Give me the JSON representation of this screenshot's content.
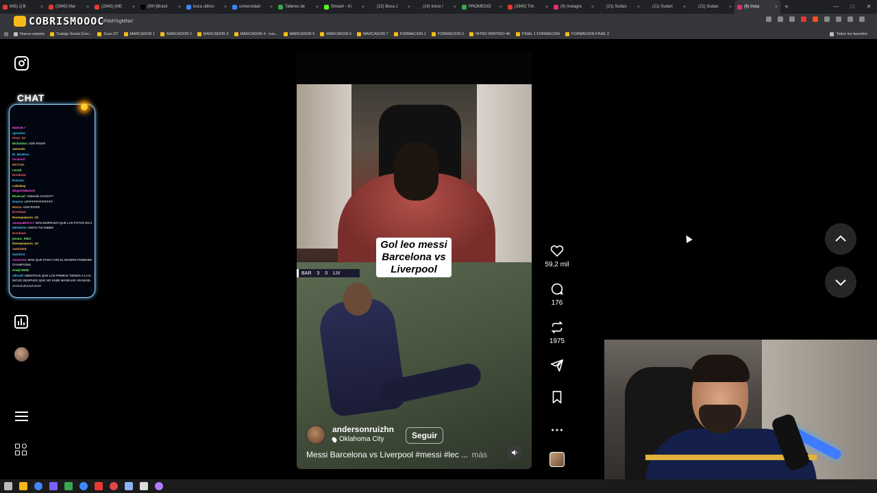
{
  "browser": {
    "tabs": [
      {
        "label": "845) Jj B",
        "color": "#e53935"
      },
      {
        "label": "(2845) Mar",
        "color": "#e53935"
      },
      {
        "label": "(2845) (ME",
        "color": "#e53935"
      },
      {
        "label": "(99+)Brasil",
        "color": "#000000"
      },
      {
        "label": "boca ultimo",
        "color": "#4285f4"
      },
      {
        "label": "universidad",
        "color": "#4285f4"
      },
      {
        "label": "Talleres de",
        "color": "#34a853"
      },
      {
        "label": "Stream - Ki",
        "color": "#53fc18"
      },
      {
        "label": "(22) Boca J",
        "color": "#222222"
      },
      {
        "label": "(16) Inicio /",
        "color": "#222222"
      },
      {
        "label": "PROMEDIO",
        "color": "#34a853"
      },
      {
        "label": "(2845) Tim",
        "color": "#e53935"
      },
      {
        "label": "(9) Instagra",
        "color": "#e1306c"
      },
      {
        "label": "(21) Sudan",
        "color": "#222222"
      },
      {
        "label": "(21) Sudan",
        "color": "#222222"
      },
      {
        "label": "(21) Sudan",
        "color": "#222222"
      },
      {
        "label": "(9) Insta",
        "color": "#e1306c",
        "active": true
      }
    ],
    "url_fragment": "/FkMYkgMNe/",
    "brand_overlay": "COBRISMOOOC",
    "bookmarks": [
      "Nueva carpeta",
      "Trabajo Social Com...",
      "Gran DT",
      "MARCADOR 1",
      "MARCADOR 2",
      "MARCADOR 3",
      "MARCADOR 4 - ove...",
      "MARCADOR 5",
      "MARCADOR 6",
      "MARCADOR 7",
      "FORMACION 1",
      "FORMACION 2",
      "INTRO PARTIDO 4K",
      "FINAL 1 FORMACION",
      "FORMACION FINAL 2"
    ],
    "all_bookmarks": "Todos los favoritos"
  },
  "sidebar": {
    "logo_icon": "instagram-icon",
    "chat_title": "CHAT",
    "chat_lines": [
      {
        "user": "Mateo8",
        "msg": "!",
        "color": "#ff4fd8"
      },
      {
        "user": "rgrnot21",
        "msg": "",
        "color": "#46c8ff"
      },
      {
        "user": "Pinto_02",
        "msg": "",
        "color": "#ff6b6b"
      },
      {
        "user": "Elchinitos",
        "msg": "ADN RIVER",
        "color": "#7cff6b"
      },
      {
        "user": "Jaevoda",
        "msg": "",
        "color": "#ffd84f"
      },
      {
        "user": "El_Mudeno",
        "msg": "",
        "color": "#46c8ff"
      },
      {
        "user": "luciano2",
        "msg": "",
        "color": "#ff4fd8"
      },
      {
        "user": "KK7716",
        "msg": "",
        "color": "#ffa64f"
      },
      {
        "user": "Leo10",
        "msg": "",
        "color": "#7cff6b"
      },
      {
        "user": "DrAdrian",
        "msg": "",
        "color": "#ff6b6b"
      },
      {
        "user": "Rumola",
        "msg": "",
        "color": "#46c8ff"
      },
      {
        "user": "LoboDay",
        "msg": "",
        "color": "#ffd84f"
      },
      {
        "user": "diegotr56bmod",
        "msg": "",
        "color": "#ff4fd8"
      },
      {
        "user": "Elcarcari",
        "msg": "Valverde el GOAT?",
        "color": "#7cff6b"
      },
      {
        "user": "Doyme",
        "msg": "UFFFFFFFFFFFFFF",
        "color": "#46c8ff"
      },
      {
        "user": "Nozzu",
        "msg": "ADN RIVER",
        "color": "#ffa64f"
      },
      {
        "user": "DrAdrian",
        "msg": "",
        "color": "#ff6b6b"
      },
      {
        "user": "Nosequepono_10",
        "msg": "",
        "color": "#ffd84f"
      },
      {
        "user": "JuanpaBOCA7",
        "msg": "MAS BORRADO QUE LAS FOTOS EN WANDA",
        "color": "#ff4fd8"
      },
      {
        "user": "NEGRON",
        "msg": "GRITO TIO RIBER",
        "color": "#46c8ff"
      },
      {
        "user": "DrAdrian",
        "msg": "",
        "color": "#ff6b6b"
      },
      {
        "user": "jovanc_felizi",
        "msg": "",
        "color": "#7cff6b"
      },
      {
        "user": "Nosequepono_10",
        "msg": "",
        "color": "#ffd84f"
      },
      {
        "user": "Jaeti1919",
        "msg": "",
        "color": "#ffa64f"
      },
      {
        "user": "SantiGO",
        "msg": "",
        "color": "#46c8ff"
      },
      {
        "user": "Jose1315",
        "msg": "MAE QUE PASO CON EL MADRID FEMENINO EN",
        "color": "#ff4fd8"
      },
      {
        "user": "",
        "msg": "CHAMPIONS",
        "color": "#ffffff"
      },
      {
        "user": "Andy72636",
        "msg": "",
        "color": "#7cff6b"
      },
      {
        "user": "Jdinolli",
        "msg": "MIENTRAS QUE LOS PRIMOS TIENEN A LA G A",
        "color": "#46c8ff"
      },
      {
        "user": "",
        "msg": "NICHO DESPUES QUE NO SABE MANEJAR UN MASIL",
        "color": "#ffffff"
      },
      {
        "user": "",
        "msg": "JAJAJAJAJAJAJAJA",
        "color": "#ffffff"
      }
    ],
    "stats_icon": "insights-icon",
    "menu_icon": "menu-icon",
    "more_icon": "more-apps-icon"
  },
  "reel": {
    "caption_overlay": [
      "Gol leo messi",
      "Barcelona vs",
      "Liverpool"
    ],
    "score": {
      "home": "BAR",
      "home_goals": "3",
      "away_goals": "0",
      "away": "LIV"
    },
    "username": "andersonruizhn",
    "location": "Oklahoma City",
    "follow_label": "Seguir",
    "description": "Messi Barcelona vs Liverpool #messi #lec ...",
    "more_label": "más"
  },
  "actions": {
    "likes": "59,2 mil",
    "comments": "176",
    "reposts": "1975"
  }
}
